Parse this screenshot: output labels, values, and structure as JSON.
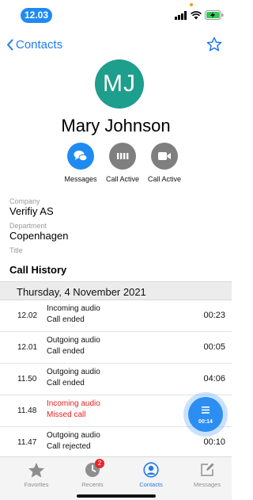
{
  "status_bar": {
    "time": "12.03"
  },
  "nav": {
    "back_label": "Contacts"
  },
  "contact": {
    "initials": "MJ",
    "name": "Mary Johnson",
    "avatar_color": "#1e9e8c"
  },
  "actions": [
    {
      "label": "Messages",
      "color": "#1f8bf0",
      "icon": "chat-bubbles-icon"
    },
    {
      "label": "Call Active",
      "color": "#7f7f7f",
      "icon": "keypad-icon"
    },
    {
      "label": "Call Active",
      "color": "#7f7f7f",
      "icon": "video-camera-icon"
    }
  ],
  "fields": {
    "company_label": "Company",
    "company_value": "Verifiy AS",
    "department_label": "Department",
    "department_value": "Copenhagen",
    "title_label": "Title",
    "title_value": ""
  },
  "call_history": {
    "title": "Call History",
    "date": "Thursday, 4 November 2021",
    "calls": [
      {
        "time": "12.02",
        "type": "Incoming audio",
        "status": "Call ended",
        "duration": "00:23",
        "missed": false
      },
      {
        "time": "12.01",
        "type": "Outgoing audio",
        "status": "Call ended",
        "duration": "00:05",
        "missed": false
      },
      {
        "time": "11.50",
        "type": "Outgoing audio",
        "status": "Call ended",
        "duration": "04:06",
        "missed": false
      },
      {
        "time": "11.48",
        "type": "Incoming audio",
        "status": "Missed call",
        "duration": "",
        "missed": true
      },
      {
        "time": "11.47",
        "type": "Outgoing audio",
        "status": "Call rejected",
        "duration": "00:10",
        "missed": false
      }
    ]
  },
  "active_call": {
    "timer": "00:14"
  },
  "tabbar": {
    "favorites": "Favorites",
    "recents": "Recents",
    "recents_badge": "2",
    "contacts": "Contacts",
    "messages": "Messages"
  },
  "colors": {
    "accent": "#1f7bf0",
    "missed": "#e82020"
  }
}
